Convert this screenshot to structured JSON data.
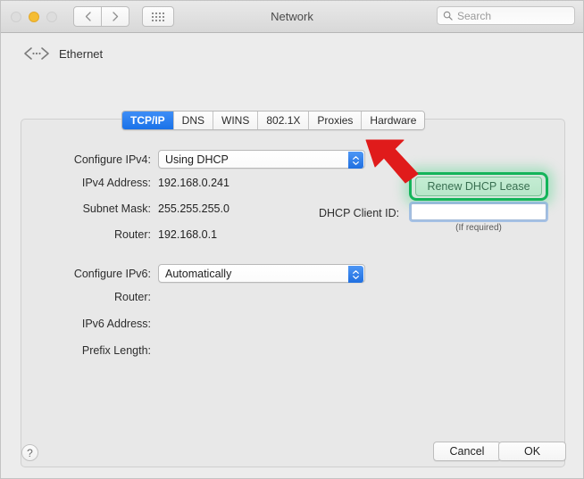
{
  "window": {
    "title": "Network",
    "traffic_lights": [
      "close",
      "minimize",
      "maximize"
    ],
    "nav": {
      "back": "‹",
      "forward": "›"
    },
    "show_all_icon": "grid-icon",
    "search": {
      "placeholder": "Search",
      "value": "",
      "icon": "search-icon"
    }
  },
  "interface": {
    "icon": "ethernet-icon",
    "name": "Ethernet"
  },
  "tabs": [
    {
      "label": "TCP/IP",
      "active": true
    },
    {
      "label": "DNS",
      "active": false
    },
    {
      "label": "WINS",
      "active": false
    },
    {
      "label": "802.1X",
      "active": false
    },
    {
      "label": "Proxies",
      "active": false
    },
    {
      "label": "Hardware",
      "active": false
    }
  ],
  "ipv4": {
    "configure_label": "Configure IPv4:",
    "configure_value": "Using DHCP",
    "address_label": "IPv4 Address:",
    "address_value": "192.168.0.241",
    "subnet_label": "Subnet Mask:",
    "subnet_value": "255.255.255.0",
    "router_label": "Router:",
    "router_value": "192.168.0.1"
  },
  "dhcp": {
    "renew_button": "Renew DHCP Lease",
    "client_id_label": "DHCP Client ID:",
    "client_id_value": "",
    "hint": "(If required)"
  },
  "ipv6": {
    "configure_label": "Configure IPv6:",
    "configure_value": "Automatically",
    "router_label": "Router:",
    "router_value": "",
    "address_label": "IPv6 Address:",
    "address_value": "",
    "prefix_label": "Prefix Length:",
    "prefix_value": ""
  },
  "footer": {
    "help": "?",
    "cancel": "Cancel",
    "ok": "OK"
  },
  "annotations": {
    "arrow": "red-arrow-pointing-to-renew-dhcp-lease",
    "highlight_color": "#14b45a",
    "arrow_color": "#e01b1b"
  },
  "colors": {
    "accent_blue": "#1a72e8",
    "window_bg": "#ececec",
    "panel_bg": "#e8e8e8"
  }
}
